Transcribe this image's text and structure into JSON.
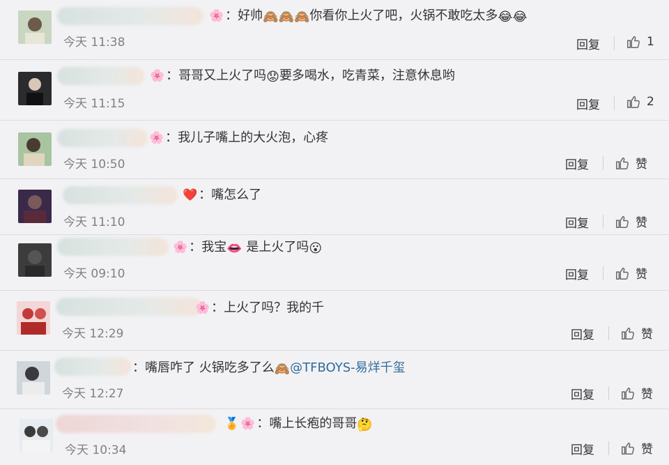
{
  "comments": [
    {
      "text": "：好帅",
      "emoji_after_text": "🙈🙈🙈",
      "text2": "你看你上火了吧，火锅不敢吃太多",
      "emoji_end": "😂😂",
      "time": "今天 11:38",
      "reply": "回复",
      "like": "1"
    },
    {
      "text": "：哥哥又上火了吗",
      "emoji_after_text": "😟",
      "text2": "要多喝水，吃青菜，注意休息哟",
      "time": "今天 11:15",
      "reply": "回复",
      "like": "2"
    },
    {
      "text": "：我儿子嘴上的大火泡，心疼",
      "time": "今天 10:50",
      "reply": "回复",
      "like": "赞"
    },
    {
      "text": "：嘴怎么了",
      "time": "今天 11:10",
      "reply": "回复",
      "like": "赞"
    },
    {
      "text": "：我宝",
      "emoji_after_text": "👄",
      "text2": " 是上火了吗",
      "emoji_end": "😮",
      "time": "今天 09:10",
      "reply": "回复",
      "like": "赞"
    },
    {
      "text": "：上火了吗？我的千",
      "time": "今天 12:29",
      "reply": "回复",
      "like": "赞"
    },
    {
      "text": "：嘴唇咋了 火锅吃多了么",
      "emoji_after_text": "🙈",
      "mention": "@TFBOYS-易烊千玺",
      "time": "今天 12:27",
      "reply": "回复",
      "like": "赞"
    },
    {
      "text": "：嘴上长疱的哥哥",
      "emoji_end": "🤔",
      "time": "今天 10:34",
      "reply": "回复",
      "like": "赞"
    }
  ],
  "icons": {
    "flower": "flower-badge-icon",
    "heart": "heart-badge-icon",
    "like": "thumbs-up-icon"
  },
  "colors": {
    "mention": "#2f6b9a",
    "background": "#f2f2f5"
  }
}
